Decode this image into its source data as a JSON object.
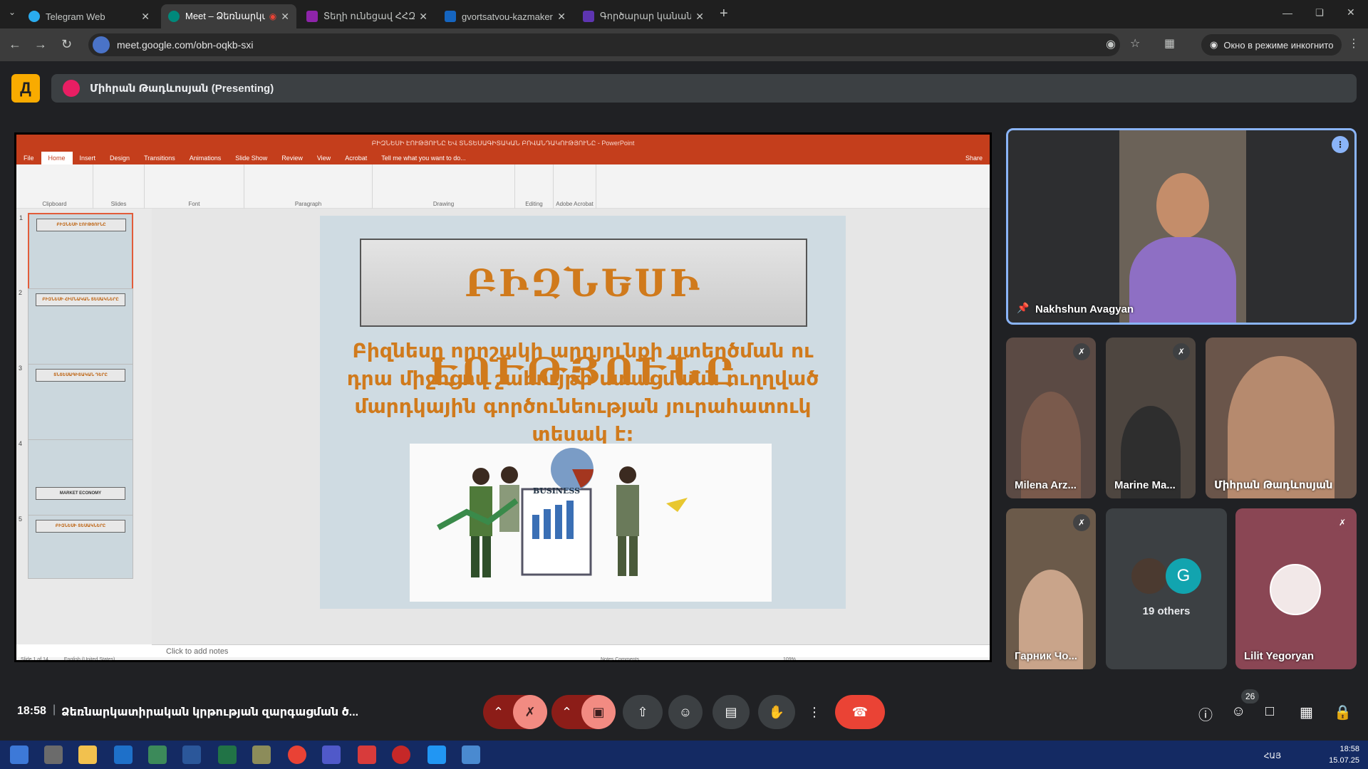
{
  "browser": {
    "tabs": [
      {
        "title": "Telegram Web",
        "color": "#2aabee"
      },
      {
        "title": "Meet – Ձեռնարկատիրակ",
        "color": "#00897b"
      },
      {
        "title": "Տեղի ունեցավ ՀՀԶՍ խորհրդ",
        "color": "#8e24aa"
      },
      {
        "title": "gvortsatvou-kazmakerpvouthy",
        "color": "#1565c0"
      },
      {
        "title": "Գործարար կանանց ակումբ",
        "color": "#5e35b1"
      }
    ],
    "url": "meet.google.com/obn-oqkb-sxi",
    "incognito_label": "Окно в режиме инкогнито"
  },
  "meet": {
    "logo_glyph": "Д",
    "presenter_label": "Միհրան Թադևոսյան (Presenting)",
    "clock": "18:58",
    "meeting_title": "Ձեռնարկատիրական կրթության զարգացման ծ...",
    "participant_count": "26"
  },
  "powerpoint": {
    "window_title": "ԲԻԶՆԵՍԻ ԷՈՒԹՅՈՒՆԸ ԵՎ ՏՆՏԵՍԱԳԻՏԱԿԱՆ ԲՈՎԱՆԴԱԿՈՒԹՅՈՒՆԸ - PowerPoint",
    "ribbon_tabs": [
      "File",
      "Home",
      "Insert",
      "Design",
      "Transitions",
      "Animations",
      "Slide Show",
      "Review",
      "View",
      "Acrobat",
      "Tell me what you want to do..."
    ],
    "share_label": "Share",
    "groups": [
      "Clipboard",
      "Slides",
      "Font",
      "Paragraph",
      "Drawing",
      "Editing",
      "Adobe Acrobat"
    ],
    "notes_placeholder": "Click to add notes",
    "status_left": "Slide 1 of 14",
    "status_lang": "English (United States)",
    "status_right": "Notes    Comments",
    "zoom": "109%",
    "slide": {
      "title": "ԲԻԶՆԵՍԻ ԷՈՒԹՅՈՒՆԸ",
      "body": "Բիզնեսը որոշակի արդյունքի ստեղծման ու դրա միջոցով շահույթի ստացմանն ուղղված մարդկային գործունեության յուրահատուկ տեսակ է:",
      "image_label": "BUSINESS"
    },
    "thumbnails": [
      {
        "num": "1",
        "label": "ԲԻԶՆԵՍԻ ԷՈՒԹՅՈՒՆԸ"
      },
      {
        "num": "2",
        "label": "ԲԻԶՆԵՍԻ ՀԻՄՆԱԿԱՆ ՏԵՍԱԿՆԵՐԸ"
      },
      {
        "num": "3",
        "label": "ՏՆՏԵՍԱԳԻՏԱԿԱՆ ԴԵՐԸ"
      },
      {
        "num": "4",
        "label": "MARKET ECONOMY"
      },
      {
        "num": "5",
        "label": "ԲԻԶՆԵՍԻ ՏԵՍԱԿՆԵՐԸ"
      }
    ]
  },
  "participants": {
    "pinned": "Nakhshun Avagyan",
    "tiles": [
      "Milena Arz...",
      "Marine Ma...",
      "Միհրան Թադևոսյան",
      "Гарник Чо...",
      "Lilit Yegoryan"
    ],
    "others_label": "19 others",
    "others_avatar_letter": "G"
  },
  "taskbar": {
    "time": "18:58",
    "date": "15.07.25",
    "lang": "ՀԱՅ"
  }
}
